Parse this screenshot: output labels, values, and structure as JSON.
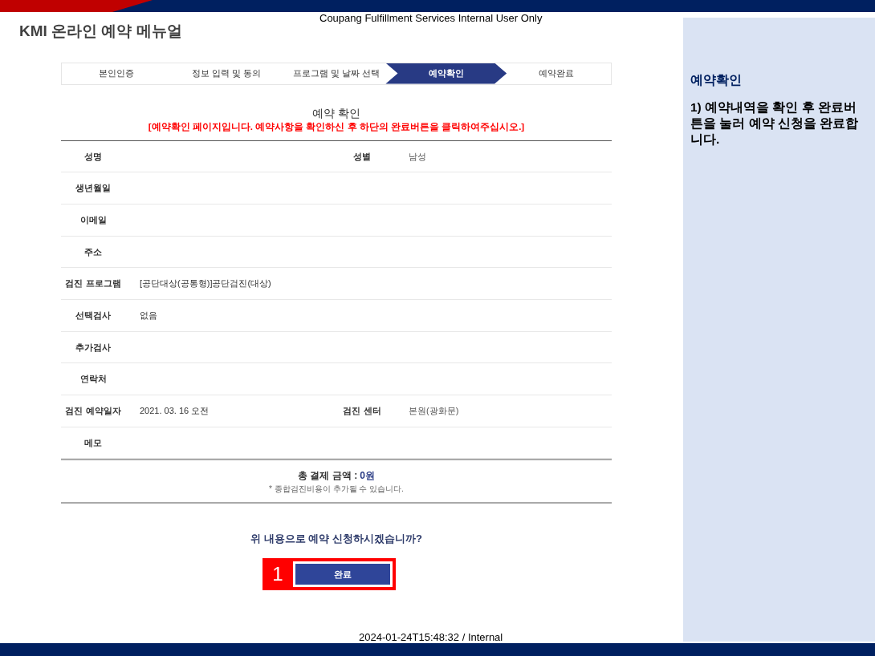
{
  "classification_top": "Coupang Fulfillment Services Internal User Only",
  "slide_title": "KMI 온라인 예약 메뉴얼",
  "steps": [
    {
      "label": "본인인증",
      "selected": false
    },
    {
      "label": "정보 입력 및 동의",
      "selected": false
    },
    {
      "label": "프로그램 및 날짜 선택",
      "selected": false
    },
    {
      "label": "예약확인",
      "selected": true
    },
    {
      "label": "예약완료",
      "selected": false
    }
  ],
  "section_title": "예약 확인",
  "notice": "[예약확인 페이지입니다. 예약사항을 확인하신 후 하단의 완료버튼을 클릭하여주십시오.]",
  "rows": [
    {
      "label": "성명",
      "label_2": "성별",
      "value_2": "남성"
    },
    {
      "label": "생년월일"
    },
    {
      "label": "이메일"
    },
    {
      "label": "주소"
    },
    {
      "label": "검진 프로그램",
      "value": "[공단대상(공통형)]공단검진(대상)"
    },
    {
      "label": "선택검사",
      "value": "없음"
    },
    {
      "label": "추가검사"
    },
    {
      "label": "연락처"
    },
    {
      "label": "검진 예약일자",
      "value": "2021. 03. 16 오전",
      "label_2": "검진 센터",
      "value_2": "본원(광화문)"
    },
    {
      "label": "메모"
    }
  ],
  "total": {
    "label": "총 결제 금액 :",
    "amount": "0원"
  },
  "total_note": "* 종합검진비용이 추가될 수 있습니다.",
  "question": "위 내용으로 예약 신청하시겠습니까?",
  "button": {
    "label": "완료",
    "callout": "1"
  },
  "side_panel": {
    "title": "예약확인",
    "text": "1)  예약내역을 확인 후 완료버튼을 눌러 예약 신청을 완료합니다."
  },
  "classification_bottom": "2024-01-24T15:48:32 / Internal"
}
